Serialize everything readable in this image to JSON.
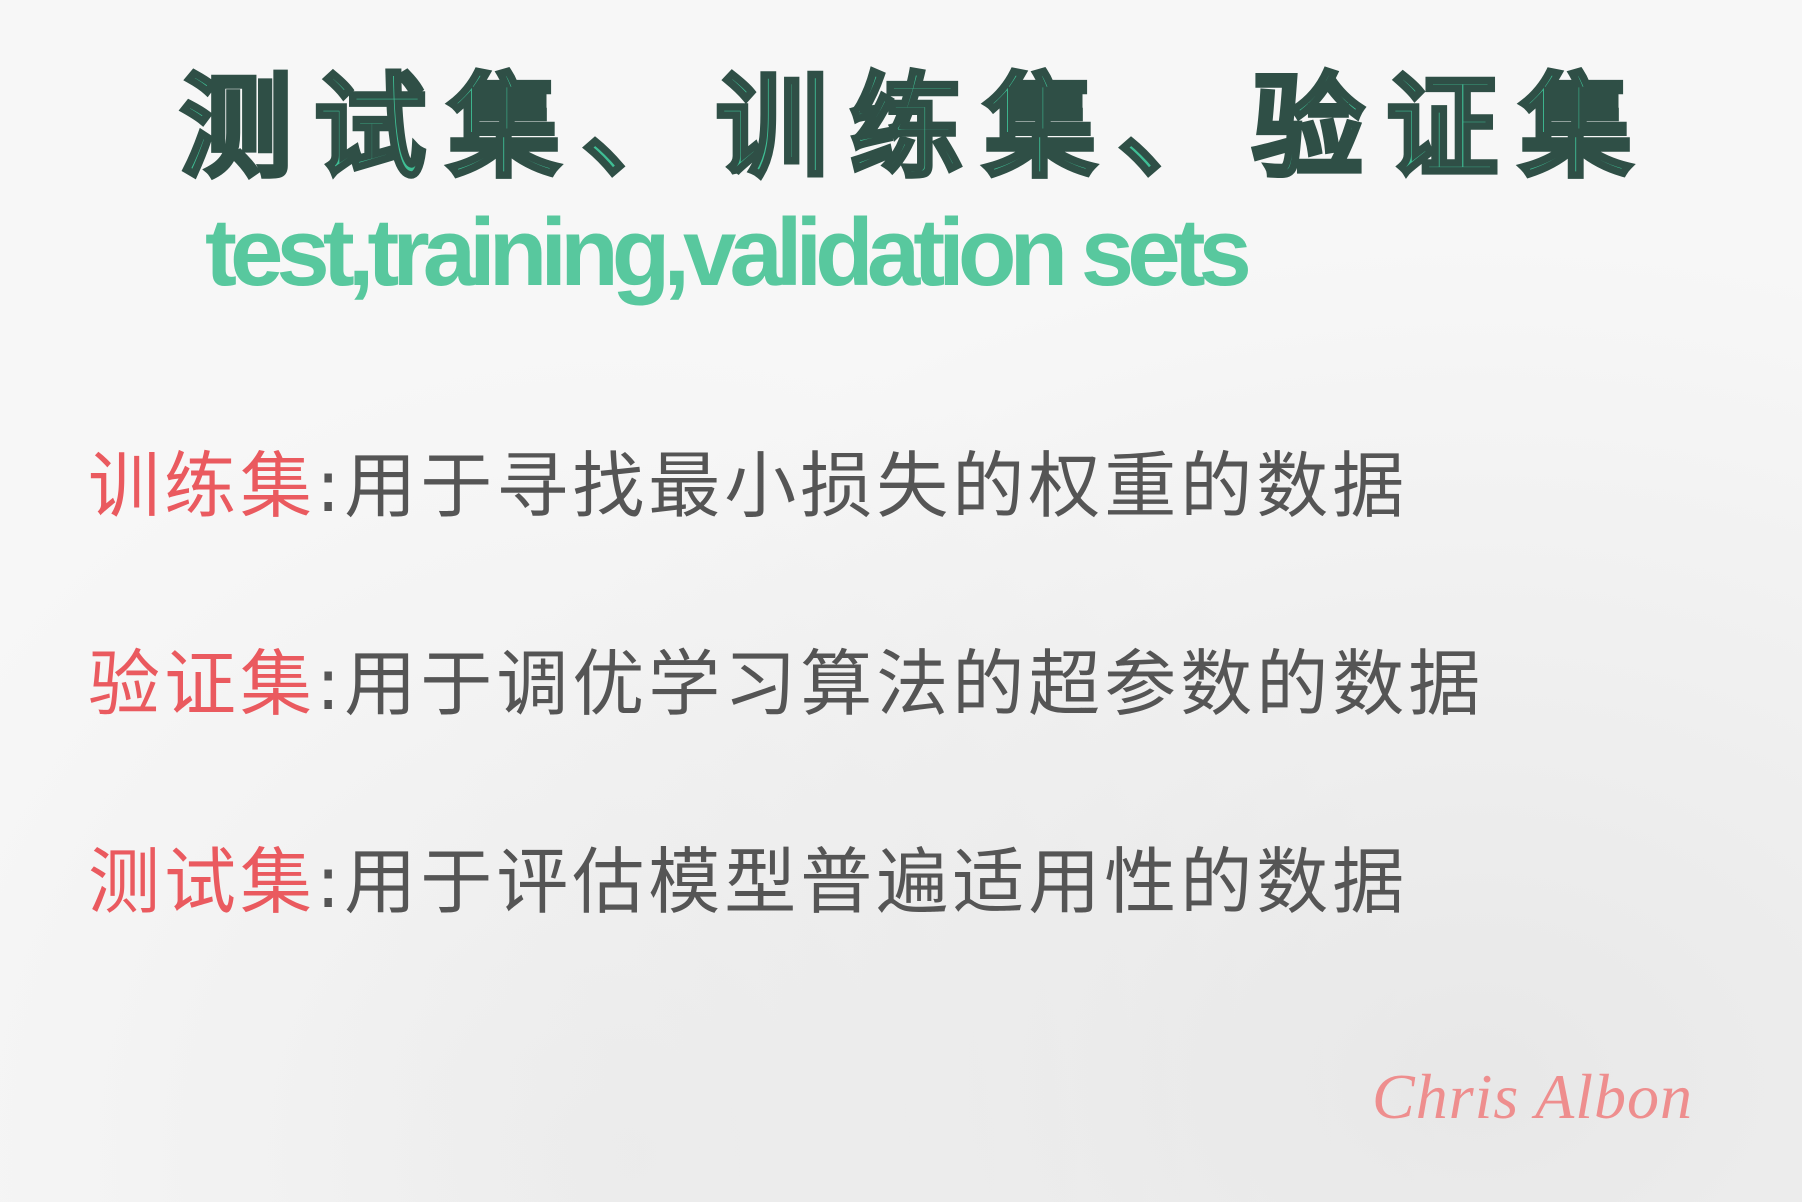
{
  "header": {
    "title_cn": "测试集、训练集、验证集",
    "title_en": "test,training,validation sets"
  },
  "definitions": [
    {
      "term": "训练集",
      "separator": ":",
      "description": "用于寻找最小损失的权重的数据"
    },
    {
      "term": "验证集",
      "separator": ":",
      "description": "用于调优学习算法的超参数的数据"
    },
    {
      "term": "测试集",
      "separator": ":",
      "description": "用于评估模型普遍适用性的数据"
    }
  ],
  "signature": "Chris Albon",
  "colors": {
    "title_green": "#3fbf95",
    "term_red": "#ea5a5f",
    "text_gray": "#555555",
    "signature_pink": "#ee8e8e"
  }
}
